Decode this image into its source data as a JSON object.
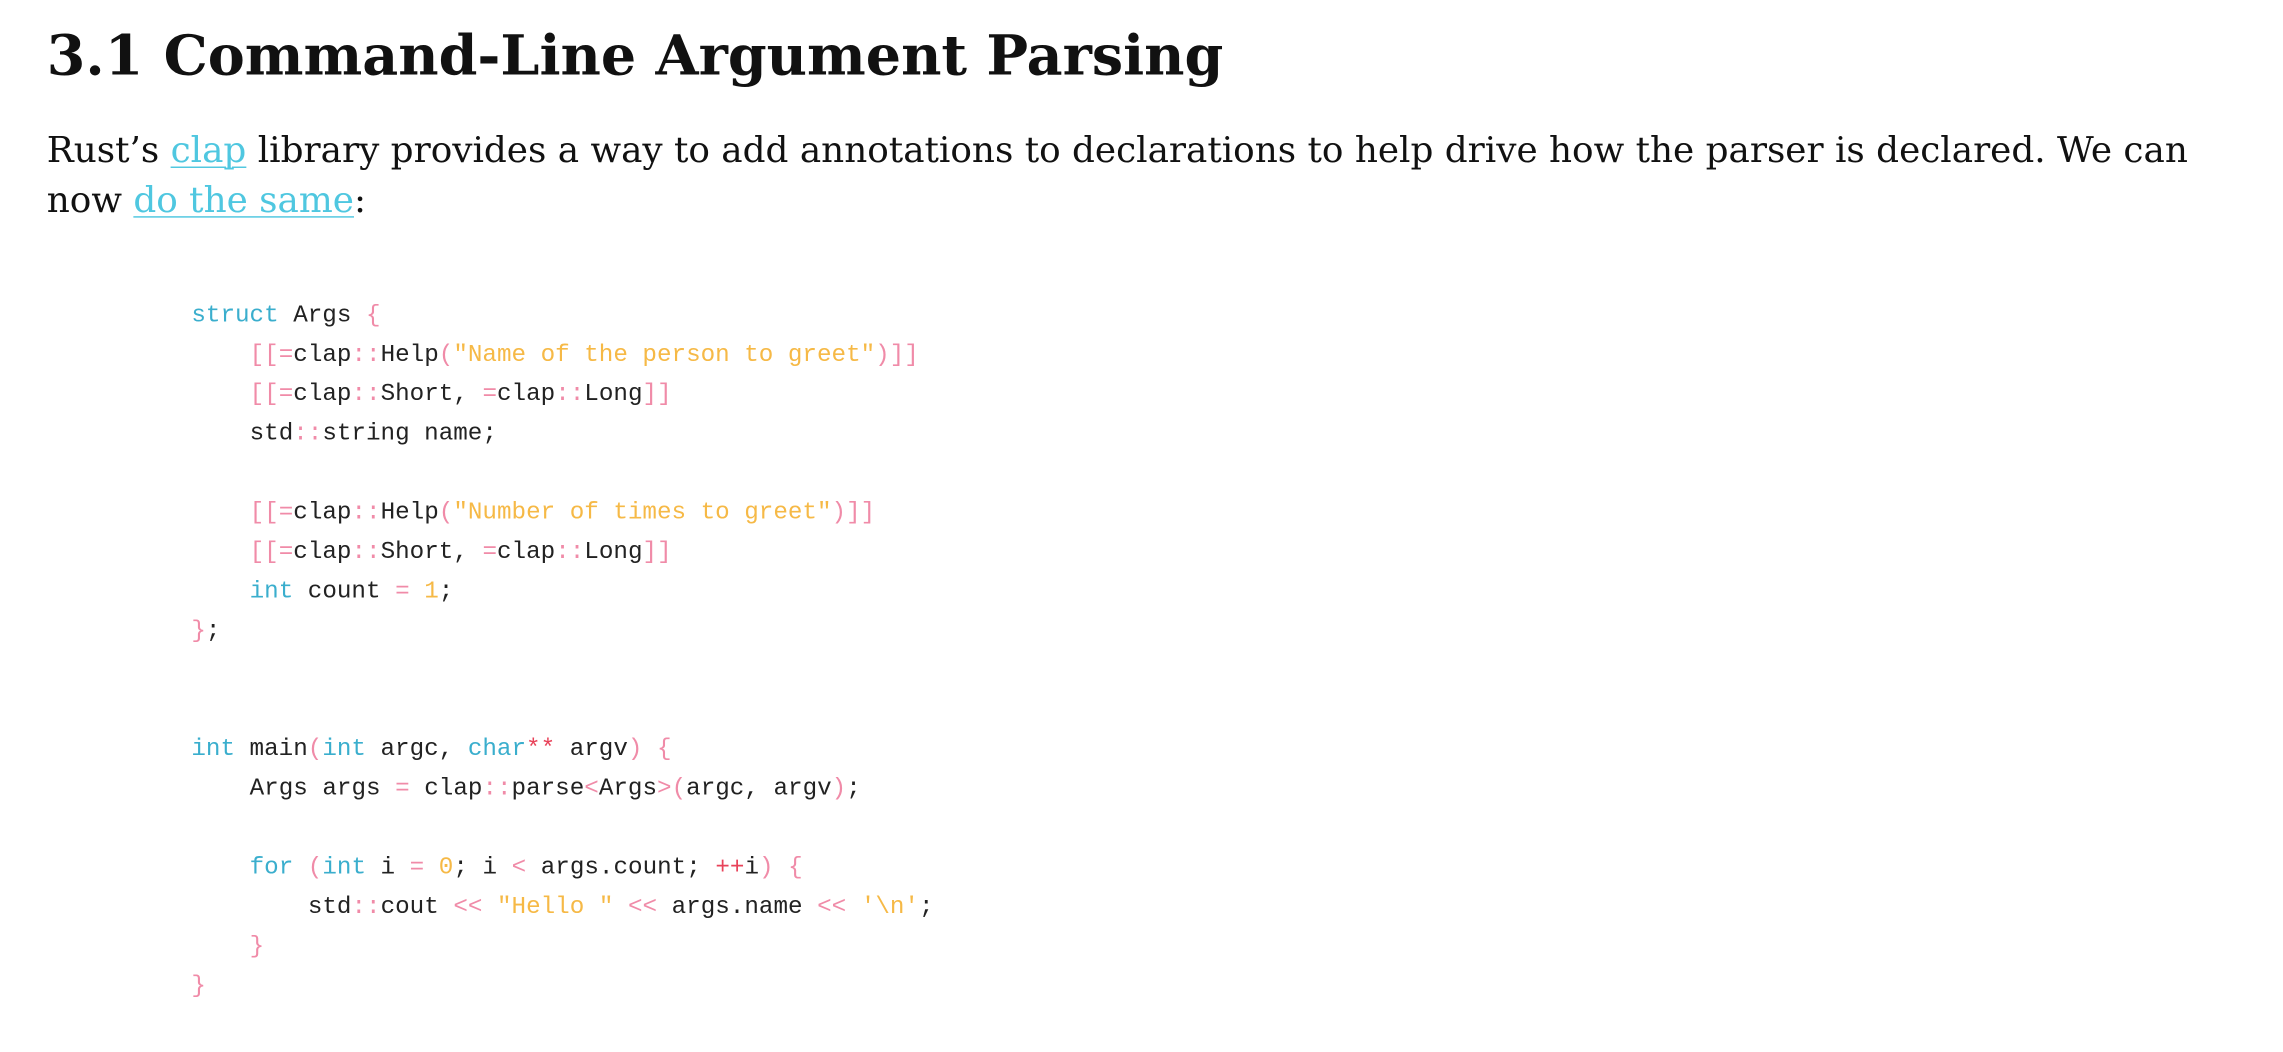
{
  "section": {
    "number": "3.1",
    "title": "Command-Line Argument Parsing"
  },
  "paragraph": {
    "text_before": "Rust’s ",
    "link1": "clap",
    "text_middle": " library provides a way to add annotations to declarations to help drive how the parser is declared. We can now ",
    "link2": "do the same",
    "text_after": ":"
  },
  "code": {
    "language": "C++",
    "lines": [
      "struct Args {",
      "    [[=clap::Help(\"Name of the person to greet\")]]",
      "    [[=clap::Short, =clap::Long]]",
      "    std::string name;",
      "",
      "    [[=clap::Help(\"Number of times to greet\")]]",
      "    [[=clap::Short, =clap::Long]]",
      "    int count = 1;",
      "};",
      "",
      "",
      "int main(int argc, char** argv) {",
      "    Args args = clap::parse<Args>(argc, argv);",
      "",
      "    for (int i = 0; i < args.count; ++i) {",
      "        std::cout << \"Hello \" << args.name << '\\n';",
      "    }",
      "}"
    ]
  },
  "colors": {
    "link": "#4fc7e0",
    "keyword": "#3aaecd",
    "punctuation": "#f08ba8",
    "string": "#f6b946",
    "number": "#f6b946",
    "operator": "#e8435a",
    "text": "#222222"
  }
}
